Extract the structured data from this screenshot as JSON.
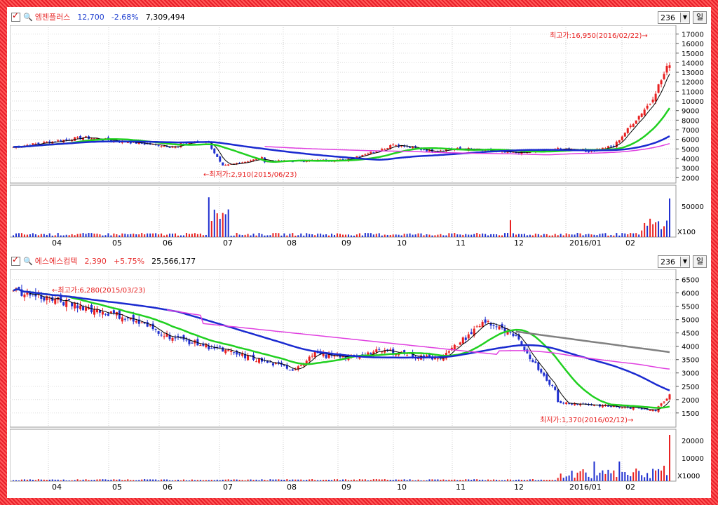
{
  "chart1": {
    "name": "엠젠플러스",
    "price": "12,700",
    "change": "-2.68%",
    "volume": "7,309,494",
    "period": "236",
    "period_unit": "일",
    "high_label": "최고가:16,950(2016/02/22)→",
    "low_label": "←최저가:2,910(2015/06/23)",
    "price_ticks": [
      "17000",
      "16000",
      "15000",
      "14000",
      "13000",
      "12000",
      "11000",
      "10000",
      "9000",
      "8000",
      "7000",
      "6000",
      "5000",
      "4000",
      "3000",
      "2000"
    ],
    "vol_ticks": [
      "50000"
    ],
    "vol_unit": "X100"
  },
  "chart2": {
    "name": "에스에스컴텍",
    "price": "2,390",
    "change": "+5.75%",
    "volume": "25,566,177",
    "period": "236",
    "period_unit": "일",
    "high_label": "←최고가:6,280(2015/03/23)",
    "low_label": "최저가:1,370(2016/02/12)→",
    "price_ticks": [
      "6500",
      "6000",
      "5500",
      "5000",
      "4500",
      "4000",
      "3500",
      "3000",
      "2500",
      "2000",
      "1500"
    ],
    "vol_ticks": [
      "20000",
      "10000"
    ],
    "vol_unit": "X1000"
  },
  "x_labels": [
    "04",
    "05",
    "06",
    "07",
    "08",
    "09",
    "10",
    "11",
    "12",
    "2016/01",
    "02"
  ],
  "colors": {
    "up": "#e82020",
    "down": "#2030d0",
    "ma5": "#000000",
    "ma20": "#20d020",
    "ma60": "#1a2ad0",
    "ma120": "#e040e0",
    "ma240": "#808080"
  }
}
